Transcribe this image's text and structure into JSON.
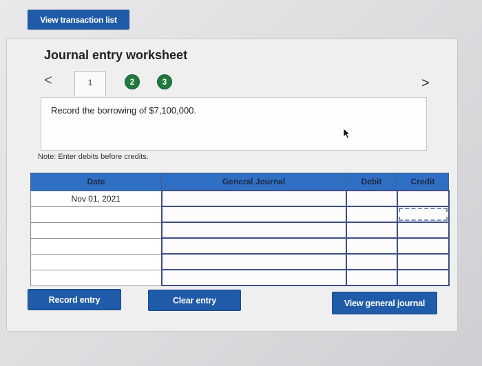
{
  "top_button": {
    "label": "View transaction list"
  },
  "worksheet": {
    "title": "Journal entry worksheet",
    "nav": {
      "prev": "<",
      "next": ">"
    },
    "steps": [
      "1",
      "2",
      "3"
    ],
    "instruction": "Record the borrowing of $7,100,000.",
    "note": "Note: Enter debits before credits."
  },
  "table": {
    "headers": {
      "date": "Date",
      "journal": "General Journal",
      "debit": "Debit",
      "credit": "Credit"
    },
    "rows": [
      {
        "date": "Nov 01, 2021",
        "account": "",
        "debit": "",
        "credit": ""
      },
      {
        "date": "",
        "account": "",
        "debit": "",
        "credit": ""
      },
      {
        "date": "",
        "account": "",
        "debit": "",
        "credit": ""
      },
      {
        "date": "",
        "account": "",
        "debit": "",
        "credit": ""
      },
      {
        "date": "",
        "account": "",
        "debit": "",
        "credit": ""
      },
      {
        "date": "",
        "account": "",
        "debit": "",
        "credit": ""
      }
    ]
  },
  "buttons": {
    "record": "Record entry",
    "clear": "Clear entry",
    "view_journal": "View general journal"
  },
  "colors": {
    "button_blue": "#1f5ba8",
    "header_blue": "#2f6fc4",
    "step_green": "#1e7a3c"
  }
}
